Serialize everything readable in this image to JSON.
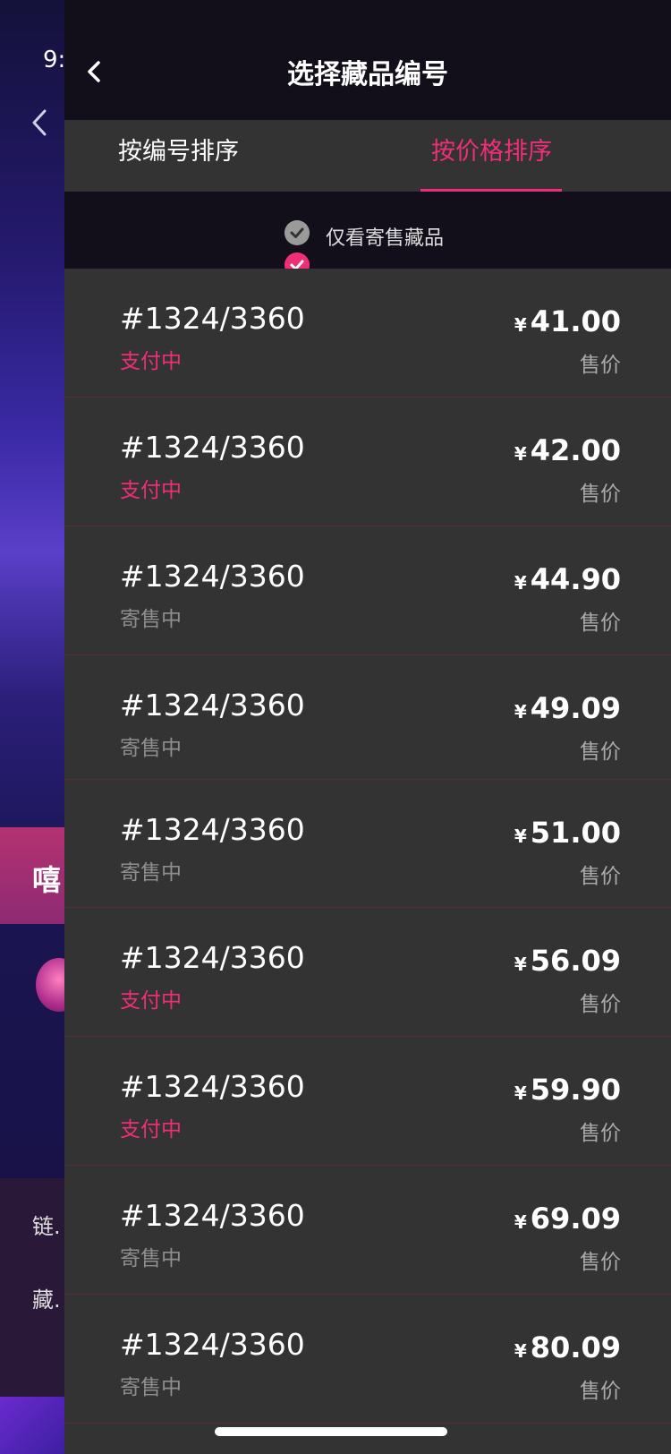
{
  "background": {
    "time_partial": "9:",
    "banner_char": "嘻",
    "lower_text1": "链.",
    "lower_text2": "藏."
  },
  "nav": {
    "title": "选择藏品编号"
  },
  "tabs": [
    {
      "label": "按编号排序",
      "active": false
    },
    {
      "label": "按价格排序",
      "active": true
    }
  ],
  "filter": {
    "label": "仅看寄售藏品"
  },
  "items": [
    {
      "number": "#1324/3360",
      "status": "支付中",
      "status_type": "paying",
      "currency": "¥",
      "price": "41.00",
      "price_label": "售价"
    },
    {
      "number": "#1324/3360",
      "status": "支付中",
      "status_type": "paying",
      "currency": "¥",
      "price": "42.00",
      "price_label": "售价"
    },
    {
      "number": "#1324/3360",
      "status": "寄售中",
      "status_type": "selling",
      "currency": "¥",
      "price": "44.90",
      "price_label": "售价"
    },
    {
      "number": "#1324/3360",
      "status": "寄售中",
      "status_type": "selling",
      "currency": "¥",
      "price": "49.09",
      "price_label": "售价"
    },
    {
      "number": "#1324/3360",
      "status": "寄售中",
      "status_type": "selling",
      "currency": "¥",
      "price": "51.00",
      "price_label": "售价"
    },
    {
      "number": "#1324/3360",
      "status": "支付中",
      "status_type": "paying",
      "currency": "¥",
      "price": "56.09",
      "price_label": "售价"
    },
    {
      "number": "#1324/3360",
      "status": "支付中",
      "status_type": "paying",
      "currency": "¥",
      "price": "59.90",
      "price_label": "售价"
    },
    {
      "number": "#1324/3360",
      "status": "寄售中",
      "status_type": "selling",
      "currency": "¥",
      "price": "69.09",
      "price_label": "售价"
    },
    {
      "number": "#1324/3360",
      "status": "寄售中",
      "status_type": "selling",
      "currency": "¥",
      "price": "80.09",
      "price_label": "售价"
    }
  ],
  "colors": {
    "accent": "#ef2e78",
    "drawer_bg": "#333333",
    "header_bg": "#120f1a"
  }
}
